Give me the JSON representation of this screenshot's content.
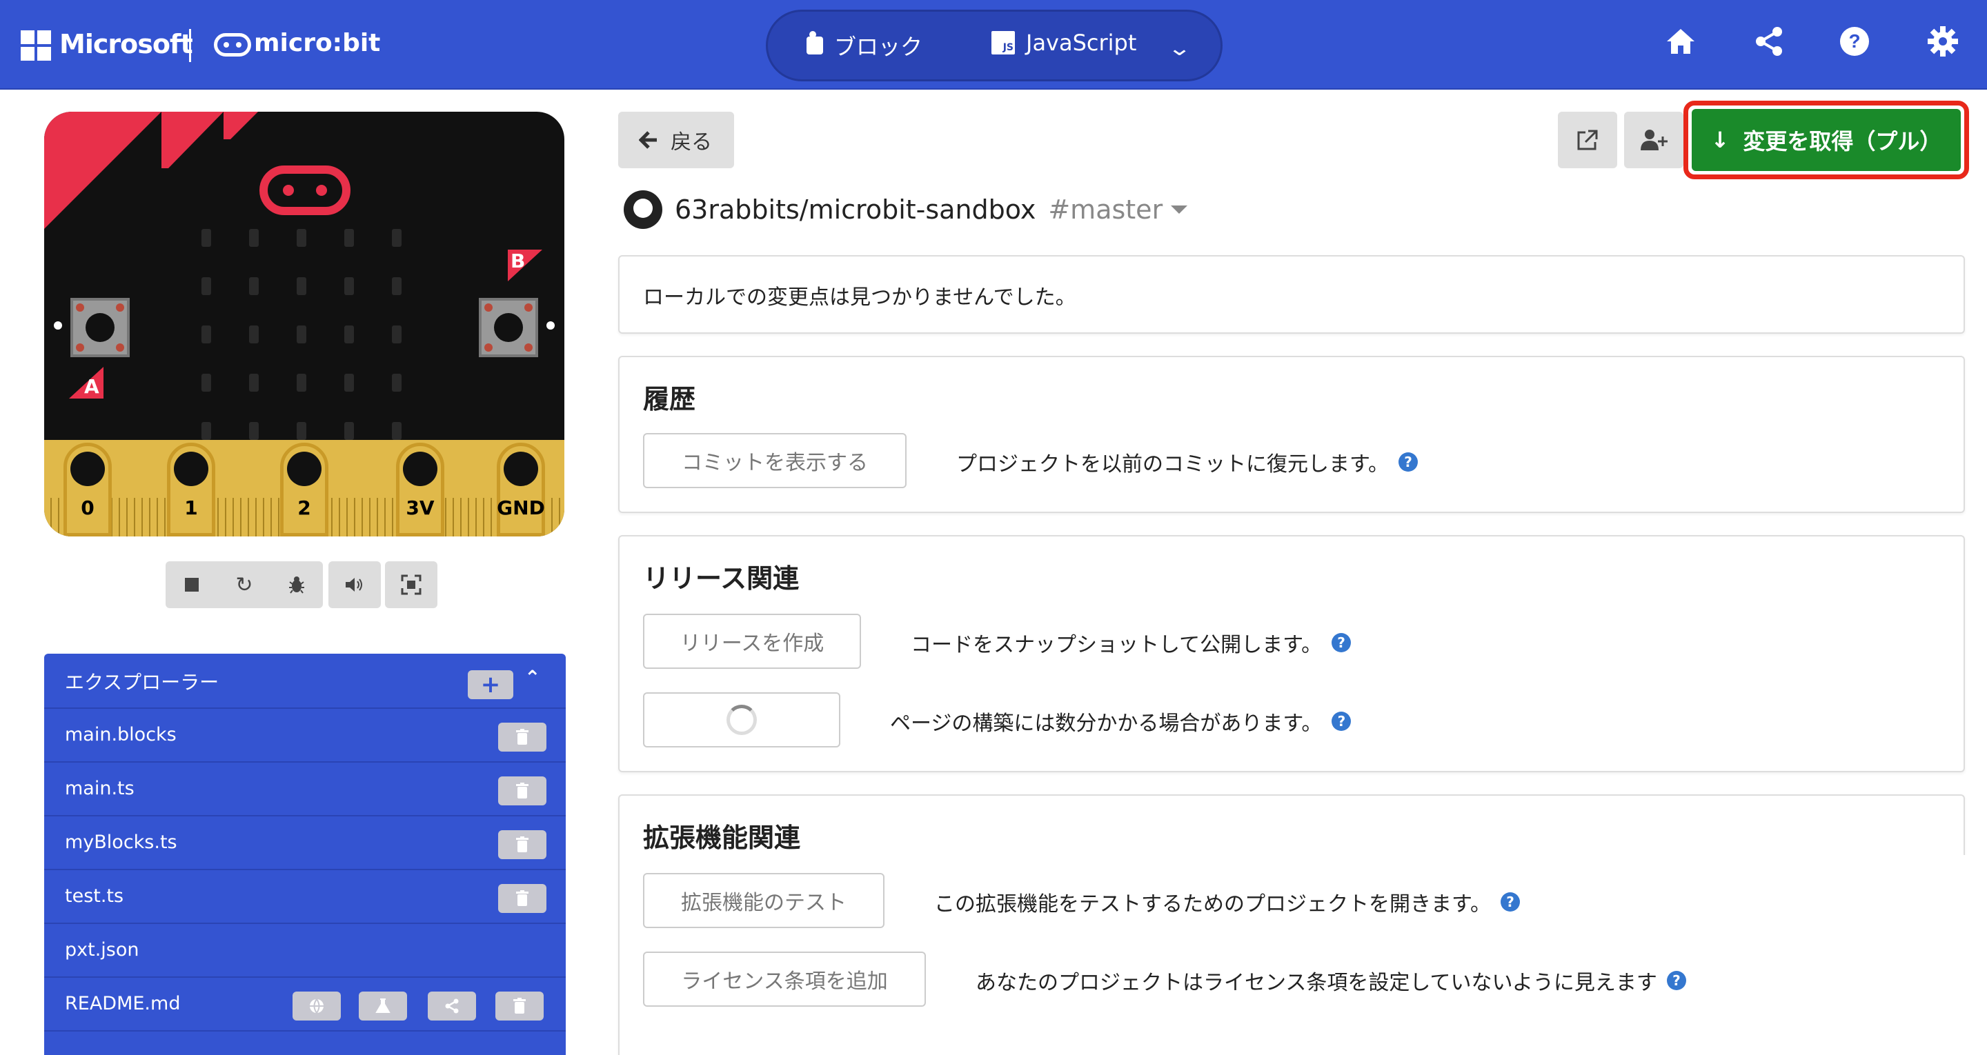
{
  "header": {
    "brand_microsoft": "Microsoft",
    "brand_microbit": "micro:bit",
    "modes": {
      "blocks_label": "ブロック",
      "js_label": "JavaScript",
      "js_badge": "JS"
    },
    "icons": [
      "home-icon",
      "share-icon",
      "help-icon",
      "settings-icon"
    ]
  },
  "simulator": {
    "button_a": "A",
    "button_b": "B",
    "pins": [
      "0",
      "1",
      "2",
      "3V",
      "GND"
    ],
    "toolbar": [
      "stop-icon",
      "restart-icon",
      "debug-icon",
      "sound-icon",
      "fullscreen-icon"
    ]
  },
  "explorer": {
    "title": "エクスプローラー",
    "files": [
      {
        "name": "main.blocks",
        "deletable": true
      },
      {
        "name": "main.ts",
        "deletable": true
      },
      {
        "name": "myBlocks.ts",
        "deletable": true
      },
      {
        "name": "test.ts",
        "deletable": true
      },
      {
        "name": "pxt.json",
        "deletable": false
      },
      {
        "name": "README.md",
        "deletable": true
      }
    ]
  },
  "github": {
    "back_label": "戻る",
    "pull_label": "変更を取得（プル）",
    "repo": "63rabbits/microbit-sandbox",
    "branch": "#master",
    "status_message": "ローカルでの変更点は見つかりませんでした。",
    "history": {
      "title": "履歴",
      "button": "コミットを表示する",
      "description": "プロジェクトを以前のコミットに復元します。"
    },
    "release": {
      "title": "リリース関連",
      "button": "リリースを作成",
      "description": "コードをスナップショットして公開します。",
      "pages_description": "ページの構築には数分かかる場合があります。"
    },
    "extension": {
      "title": "拡張機能関連",
      "test_button": "拡張機能のテスト",
      "test_description": "この拡張機能をテストするためのプロジェクトを開きます。",
      "license_button": "ライセンス条項を追加",
      "license_description": "あなたのプロジェクトはライセンス条項を設定していないように見えます"
    }
  },
  "colors": {
    "header_blue": "#3454d1",
    "pull_green": "#1a8a2a",
    "highlight_red": "#e8281a",
    "board_red": "#e8304a",
    "edge_gold": "#e0b94a"
  }
}
